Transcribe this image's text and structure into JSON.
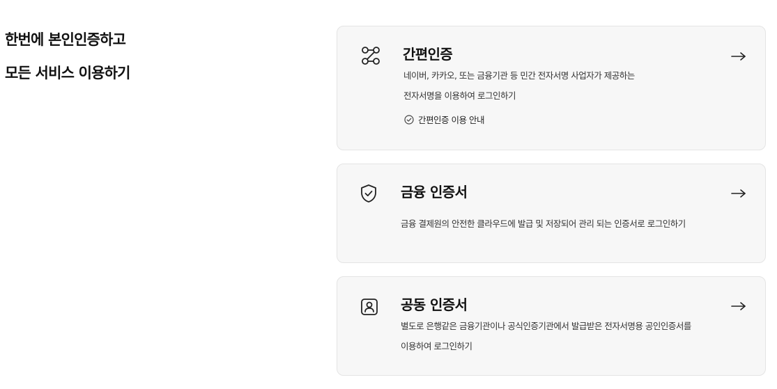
{
  "headline": {
    "line1": "한번에 본인인증하고",
    "line2": "모든 서비스 이용하기"
  },
  "cards": [
    {
      "icon": "route-path-icon",
      "title": "간편인증",
      "desc_line1": "네이버, 카카오, 또는 금융기관 등 민간 전자서명 사업자가 제공하는",
      "desc_line2": "전자서명을 이용하여 로그인하기",
      "guide_link": "간편인증 이용 안내"
    },
    {
      "icon": "shield-check-icon",
      "title": "금융 인증서",
      "desc_line1": "금융 결제원의 안전한 클라우드에 발급 및 저장되어 관리 되는 인증서로 로그인하기"
    },
    {
      "icon": "user-badge-icon",
      "title": "공동 인증서",
      "desc_line1": "별도로 은행같은 금융기관이나 공식인증기관에서 발급받은 전자서명용 공인인증서를",
      "desc_line2": "이용하여 로그인하기"
    }
  ],
  "colors": {
    "card_background": "#f7f7f7",
    "card_border": "#e4e4e4",
    "text_primary": "#111111",
    "text_secondary": "#333333"
  }
}
